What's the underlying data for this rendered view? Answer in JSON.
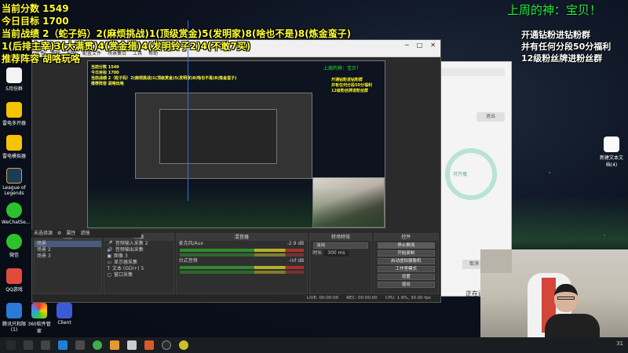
{
  "overlay": {
    "score": "当前分数 1549",
    "target": "今日目标 1700",
    "record": "当前战绩 2（蛇子妈）2(麻烦挑战)1(顶级赏金)5(发明家)8(啥也不是)8(炼金蛮子)",
    "record2": "1(后排主宰)3(大满贯)4(赏金猎)4(发明铃子2)4(不敢7买)",
    "lineup": "推荐阵容 胡咯玩咯",
    "god_banner": "上周的神：宝贝！",
    "promo": [
      "开通钻粉进钻粉群",
      "并有任何分段50分福利",
      "12级粉丝牌进粉丝群"
    ]
  },
  "desktop_icons": [
    {
      "label": "5月份群"
    },
    {
      "label": "雷电多开器"
    },
    {
      "label": "雷电模拟器"
    },
    {
      "label": "League of Legends"
    },
    {
      "label": "WeChatSe..."
    },
    {
      "label": "微信"
    },
    {
      "label": "QQ游戏"
    },
    {
      "label": "腾讯只和限(1)"
    },
    {
      "label": "360软件管家"
    },
    {
      "label": "Client"
    }
  ],
  "right_desktop_icon": {
    "label": "新建文本文档(4)"
  },
  "obs": {
    "title": "OBS",
    "menu": [
      "文件",
      "编辑",
      "视图",
      "配置文件",
      "场景集合",
      "工具",
      "帮助"
    ],
    "preview_overlay_score": "当前分数 1549",
    "preview_overlay_target": "今日目标 1700",
    "preview_overlay_record": "当前战绩 2（蛇子妈）2(麻烦挑战)1(顶级赏金)5(发明家)8(啥也不是)8(炼金蛮子)",
    "preview_overlay_lineup": "推荐阵容 胡咯玩咯",
    "preview_god": "上周的神：宝贝！",
    "preview_promo": [
      "开通钻粉进钻粉群",
      "并有任何分段50分福利",
      "12级粉丝牌进粉丝群"
    ],
    "scene_label": "未选择源",
    "props_btn": "属性",
    "filters_btn": "滤镜",
    "panels": {
      "scenes": {
        "title": "场景",
        "items": [
          "场景",
          "场景 2",
          "场景 3"
        ]
      },
      "sources": {
        "title": "来源",
        "items": [
          "音频输入采集 2",
          "音频输出采集",
          "图像 3",
          "显示器采集",
          "文本 (GDI+) 5",
          "窗口采集"
        ]
      },
      "mixer": {
        "title": "混音器",
        "channels": [
          {
            "name": "麦克风/Aux",
            "db": "-2.9 dB"
          },
          {
            "name": "台式音频",
            "db": "-inf dB"
          }
        ]
      },
      "transitions": {
        "title": "转场特效",
        "type": "淡出",
        "duration_label": "时长",
        "duration": "300 ms"
      },
      "controls": {
        "title": "控件",
        "buttons": [
          "停止推流",
          "开始录制",
          "启动虚拟摄像机",
          "工作室模式",
          "设置",
          "退出"
        ]
      }
    },
    "status": {
      "live": "LIVE: 00:00:00",
      "rec": "REC: 00:00:00",
      "cpu": "CPU: 1.9%, 30.00 fps"
    }
  },
  "appwin": {
    "button": "退出",
    "inner": "可开播",
    "bottom_btn": "取消",
    "footer": "正在进行"
  },
  "taskbar": {
    "tray": "31"
  }
}
